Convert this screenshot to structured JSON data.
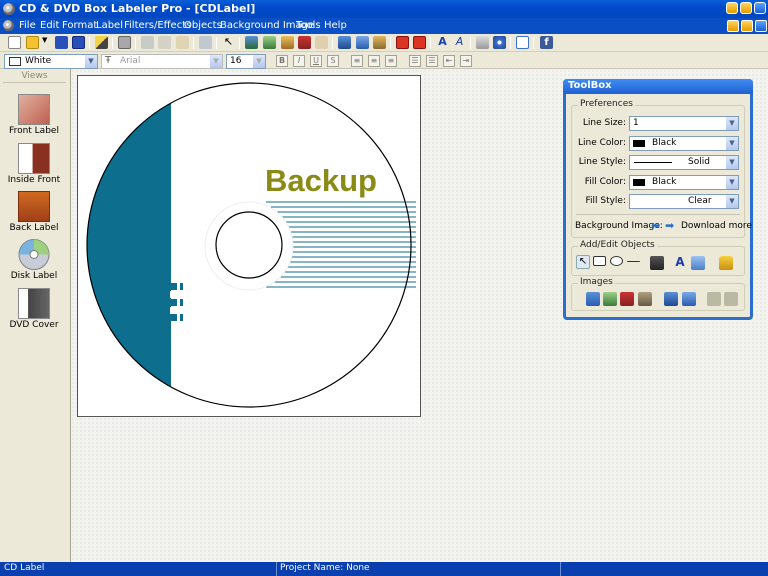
{
  "window": {
    "title": "CD & DVD Box Labeler Pro - [CDLabel]"
  },
  "menu": [
    "File",
    "Edit",
    "Format",
    "Label",
    "Filters/Effects",
    "Objects",
    "Background Image",
    "Tools",
    "Help"
  ],
  "format_bar": {
    "color_value": "White",
    "font_value": "Arial",
    "size_value": "16"
  },
  "views": {
    "header": "Views",
    "items": [
      "Front Label",
      "Inside Front",
      "Back Label",
      "Disk Label",
      "DVD Cover"
    ]
  },
  "label": {
    "text": "Backup",
    "text_color": "#8a8a16",
    "accent_color": "#0e6e8e"
  },
  "toolbox": {
    "title": "ToolBox",
    "preferences": {
      "title": "Preferences",
      "line_size_label": "Line Size:",
      "line_size": "1",
      "line_color_label": "Line Color:",
      "line_color": "Black",
      "line_style_label": "Line Style:",
      "line_style": "Solid",
      "fill_color_label": "Fill Color:",
      "fill_color": "Black",
      "fill_style_label": "Fill Style:",
      "fill_style": "Clear",
      "bg_image_label": "Background Image:",
      "download_more": "Download more"
    },
    "add_edit_title": "Add/Edit Objects",
    "images_title": "Images"
  },
  "status": {
    "left": "CD Label",
    "project": "Project Name: None"
  }
}
